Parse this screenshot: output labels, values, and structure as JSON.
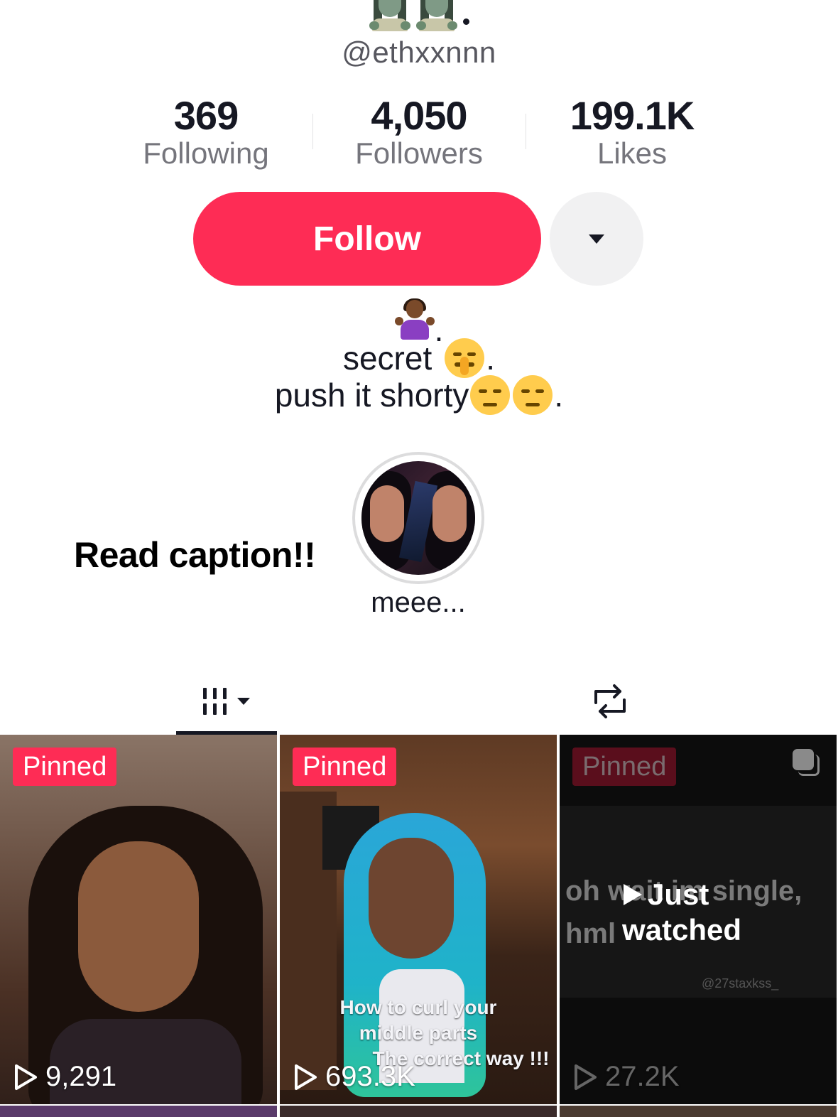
{
  "profile": {
    "username": "@ethxxnnn",
    "top_emojis": [
      "zombie-emoji",
      "zombie-emoji"
    ],
    "stats": [
      {
        "value": "369",
        "label": "Following"
      },
      {
        "value": "4,050",
        "label": "Followers"
      },
      {
        "value": "199.1K",
        "label": "Likes"
      }
    ],
    "follow_label": "Follow",
    "bio": {
      "line1_suffix": ".",
      "line2_text": "secret",
      "line2_suffix": ".",
      "line3_text": "push it shorty",
      "line3_suffix": "."
    }
  },
  "overlay_caption": "Read caption!!",
  "highlight": {
    "label": "meee..."
  },
  "tabs": [
    {
      "name": "videos",
      "icon": "grid-icon",
      "active": true
    },
    {
      "name": "reposts",
      "icon": "repost-icon",
      "active": false
    }
  ],
  "videos": [
    {
      "badge": "Pinned",
      "views": "9,291"
    },
    {
      "badge": "Pinned",
      "views": "693.3K",
      "overlay_lines": [
        "How to curl your",
        "middle parts",
        "The correct way !!!"
      ]
    },
    {
      "badge": "Pinned",
      "views": "27.2K",
      "status_line1": "Just",
      "status_line2": "watched",
      "bg_text1": "oh wait im single,",
      "bg_text2": "hml",
      "watermark": "@27staxkss_"
    }
  ],
  "colors": {
    "accent": "#fe2c55",
    "text": "#161823",
    "secondary": "#75757c"
  }
}
